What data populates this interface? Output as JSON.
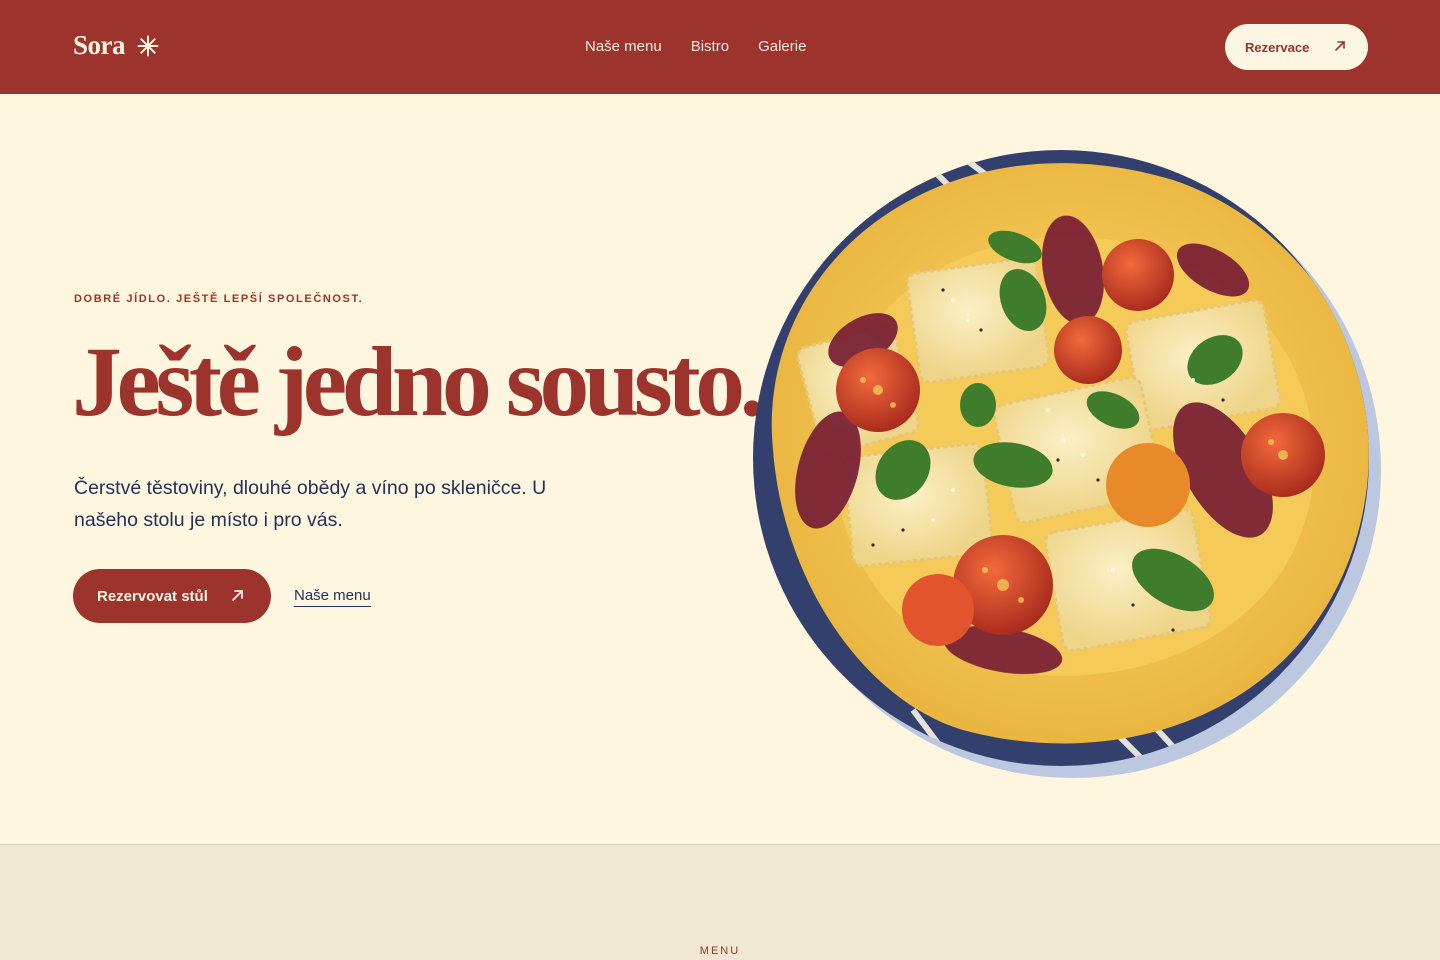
{
  "header": {
    "logo_text": "Sora",
    "nav": [
      "Naše menu",
      "Bistro",
      "Galerie"
    ],
    "cta_label": "Rezervace"
  },
  "hero": {
    "eyebrow": "DOBRÉ JÍDLO. JEŠTĚ LEPŠÍ SPOLEČNOST.",
    "headline": "Ještě jedno sousto.",
    "lead": "Čerstvé těstoviny, dlouhé obědy a víno po skleničce. U našeho stolu je místo i pro vás.",
    "primary_cta": "Rezervovat stůl",
    "secondary_link": "Naše menu"
  },
  "menu_section": {
    "eyebrow": "MENU"
  },
  "colors": {
    "brand_red": "#9c332c",
    "cream": "#fef6de",
    "navy": "#24325a",
    "section_beige": "#f0e8d2"
  },
  "icons": [
    "asterisk-icon",
    "arrow-up-right-icon"
  ]
}
